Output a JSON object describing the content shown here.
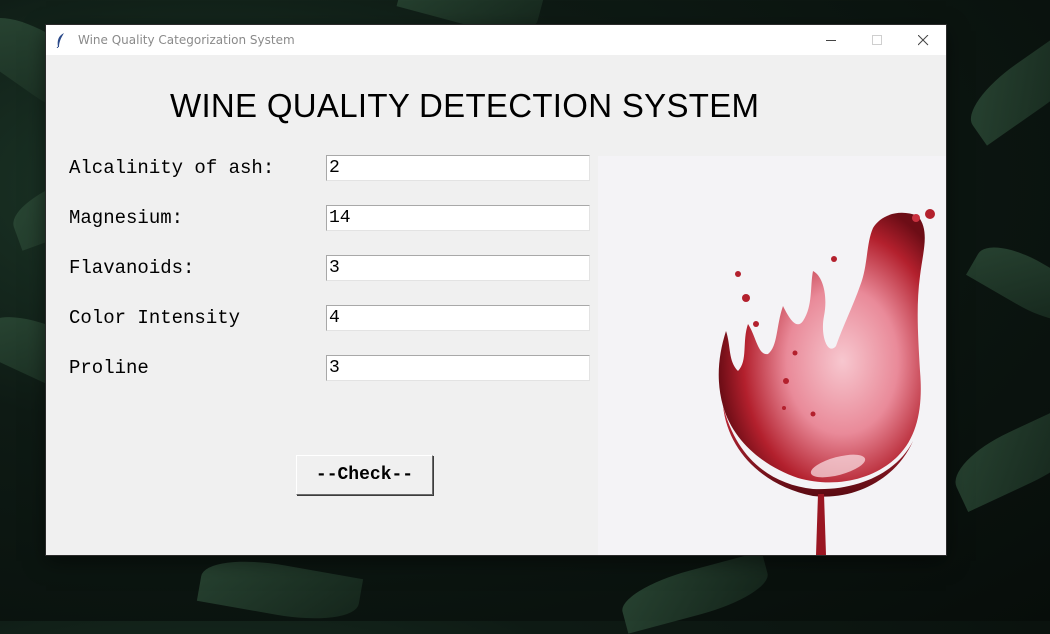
{
  "window": {
    "title": "Wine Quality Categorization System",
    "controls": {
      "minimize": "—",
      "maximize": "☐",
      "close": "✕"
    }
  },
  "heading": "WINE QUALITY DETECTION SYSTEM",
  "fields": [
    {
      "label": "Alcalinity of ash:",
      "value": "2"
    },
    {
      "label": "Magnesium:",
      "value": "14"
    },
    {
      "label": "Flavanoids:",
      "value": "3"
    },
    {
      "label": "Color Intensity",
      "value": "4"
    },
    {
      "label": "Proline",
      "value": "3"
    }
  ],
  "check_button": "--Check--",
  "colors": {
    "wine": "#b3202d",
    "wine_light": "#f2b3bd",
    "window_bg": "#f0f0f0"
  },
  "icons": {
    "app": "feather-icon",
    "image": "wine-glass-splash"
  }
}
